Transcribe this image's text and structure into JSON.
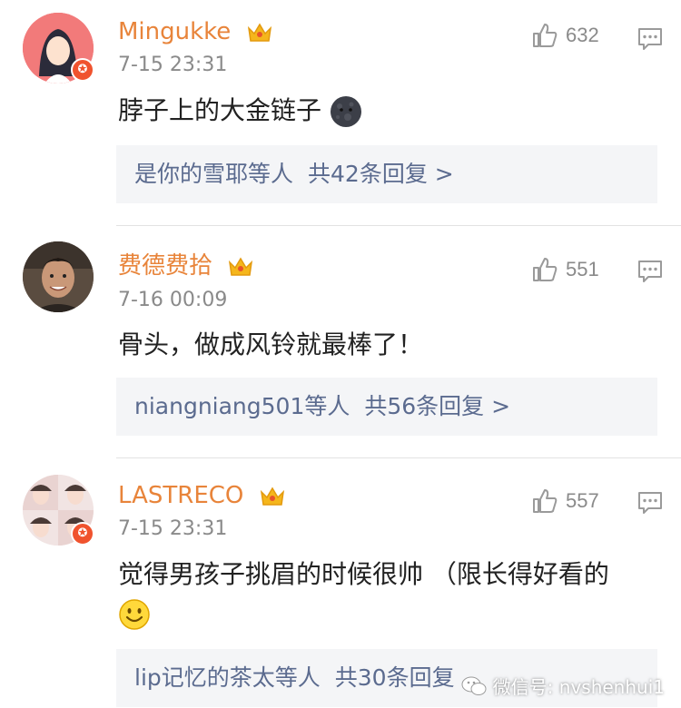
{
  "comments": [
    {
      "username": "Mingukke",
      "time": "7-15 23:31",
      "likes": "632",
      "content": "脖子上的大金链子",
      "replies_users": "是你的雪耶等人",
      "replies_count": "共42条回复 >"
    },
    {
      "username": "费德费拾",
      "time": "7-16 00:09",
      "likes": "551",
      "content": "骨头，做成风铃就最棒了！",
      "replies_users": "niangniang501等人",
      "replies_count": "共56条回复 >"
    },
    {
      "username": "LASTRECO",
      "time": "7-15 23:31",
      "likes": "557",
      "content": "觉得男孩子挑眉的时候很帅 （限长得好看的",
      "replies_users": "lip记忆的茶太等人",
      "replies_count": "共30条回复"
    }
  ],
  "watermark": "微信号: nvshenhui1",
  "colors": {
    "username": "#e8843a",
    "link": "#5b6b8f",
    "badge": "#f0532e",
    "crown": "#f5b61c"
  }
}
